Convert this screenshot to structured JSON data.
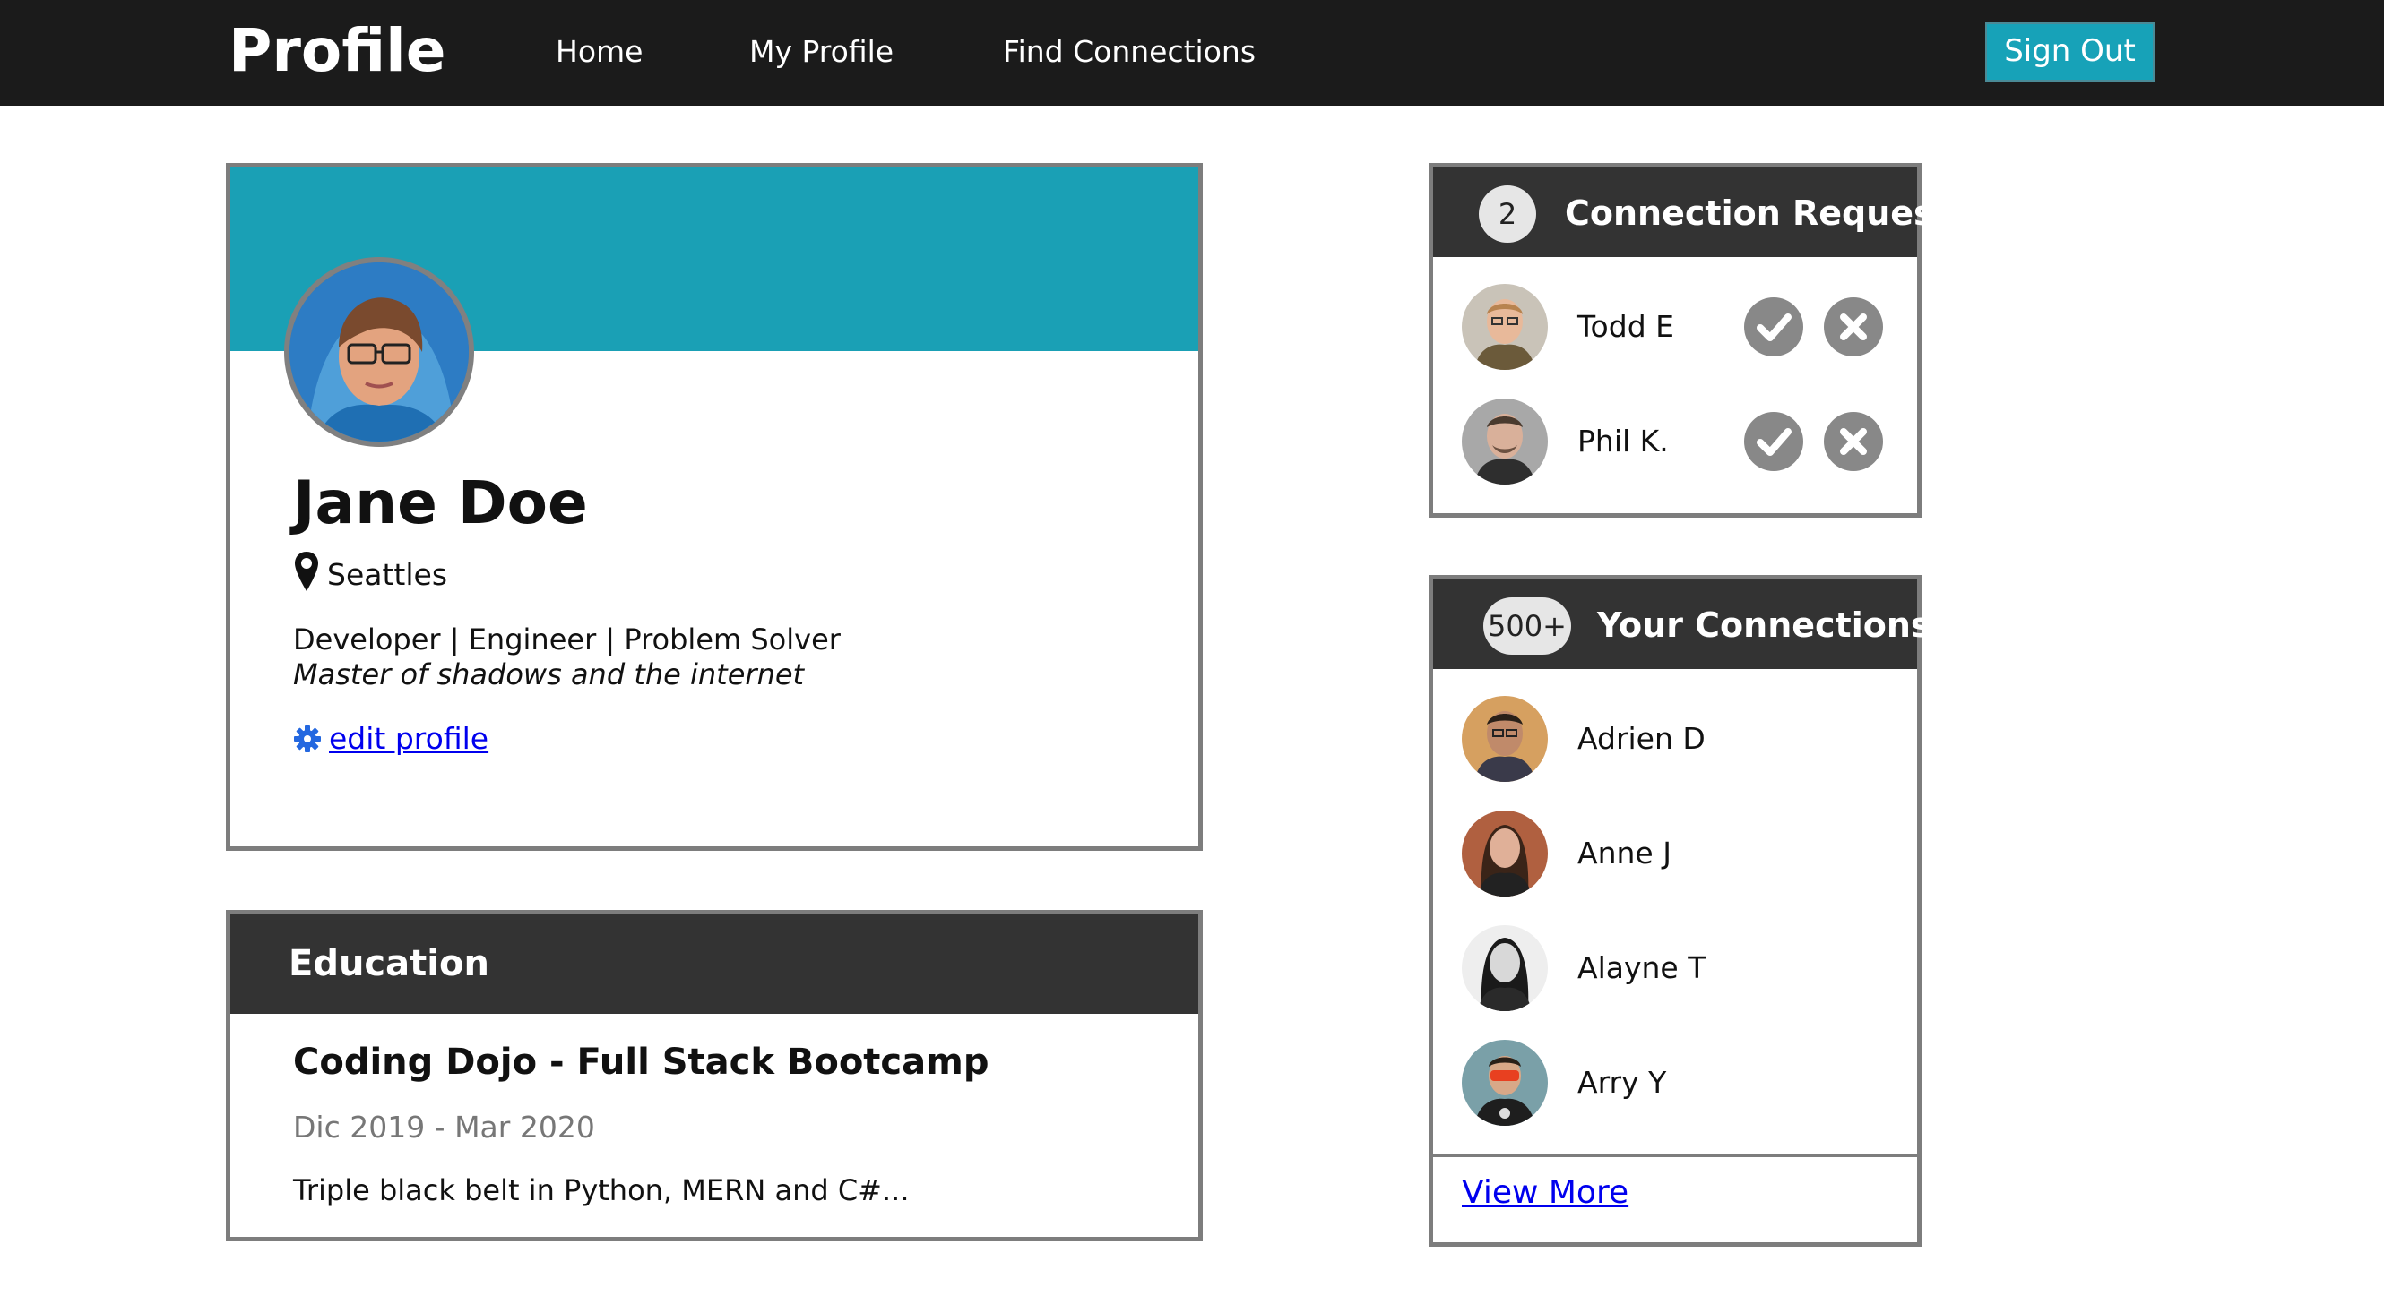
{
  "nav": {
    "brand": "Profile",
    "home": "Home",
    "my_profile": "My Profile",
    "find_connections": "Find Connections",
    "sign_out": "Sign Out"
  },
  "profile": {
    "name": "Jane Doe",
    "location": "Seattles",
    "bio_line1": "Developer | Engineer | Problem Solver",
    "bio_line2": "Master of shadows and the internet",
    "edit_label": "edit profile"
  },
  "education": {
    "header": "Education",
    "school": "Coding Dojo - Full Stack Bootcamp",
    "dates": "Dic 2019 - Mar 2020",
    "description": "Triple black belt in Python, MERN and C#..."
  },
  "connection_requests": {
    "count": "2",
    "title": "Connection Request",
    "people": [
      {
        "name": "Todd E"
      },
      {
        "name": "Phil K."
      }
    ]
  },
  "connections": {
    "count": "500+",
    "title": "Your Connections",
    "people": [
      {
        "name": "Adrien D"
      },
      {
        "name": "Anne J"
      },
      {
        "name": "Alayne T"
      },
      {
        "name": "Arry Y"
      }
    ],
    "view_more": "View More"
  },
  "colors": {
    "accent": "#17a2b8",
    "banner": "#1aa0b5",
    "nav_bg": "#1b1b1b",
    "card_header": "#333333",
    "link": "#0000ee",
    "action_icon": "#888888"
  }
}
